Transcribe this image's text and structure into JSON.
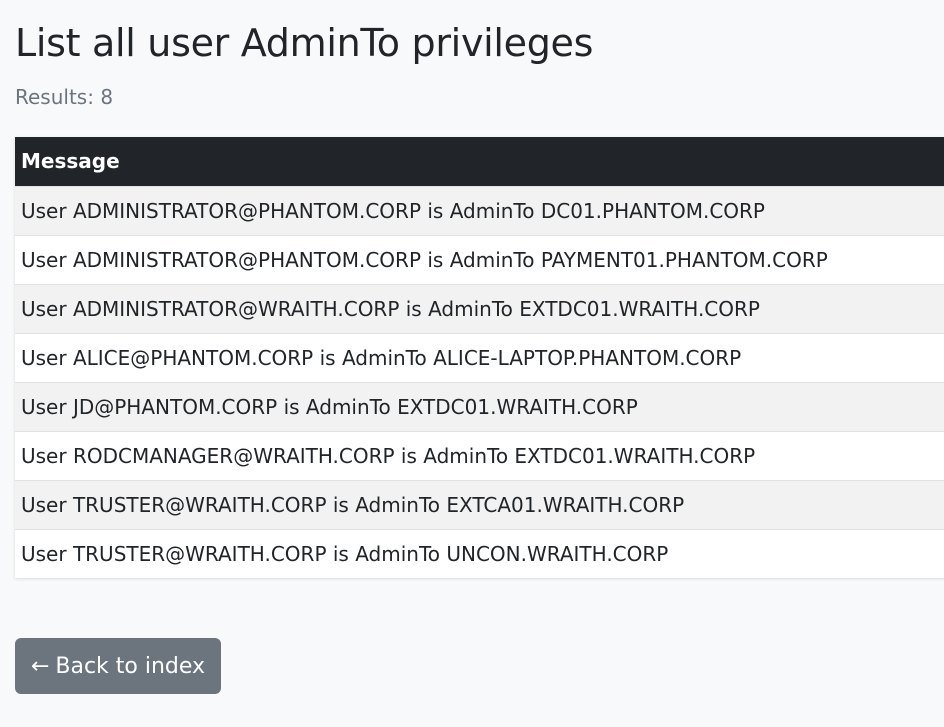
{
  "page": {
    "title": "List all user AdminTo privileges",
    "results_text": "Results: 8"
  },
  "table": {
    "header": "Message",
    "rows": [
      "User ADMINISTRATOR@PHANTOM.CORP is AdminTo DC01.PHANTOM.CORP",
      "User ADMINISTRATOR@PHANTOM.CORP is AdminTo PAYMENT01.PHANTOM.CORP",
      "User ADMINISTRATOR@WRAITH.CORP is AdminTo EXTDC01.WRAITH.CORP",
      "User ALICE@PHANTOM.CORP is AdminTo ALICE-LAPTOP.PHANTOM.CORP",
      "User JD@PHANTOM.CORP is AdminTo EXTDC01.WRAITH.CORP",
      "User RODCMANAGER@WRAITH.CORP is AdminTo EXTDC01.WRAITH.CORP",
      "User TRUSTER@WRAITH.CORP is AdminTo EXTCA01.WRAITH.CORP",
      "User TRUSTER@WRAITH.CORP is AdminTo UNCON.WRAITH.CORP"
    ]
  },
  "back_button": {
    "arrow": "←",
    "label": "Back to index",
    "icon": "left-arrow-icon"
  },
  "colors": {
    "background": "#f8f9fa",
    "header_bg": "#212529",
    "button_bg": "#6c757d",
    "muted_text": "#6c757d"
  }
}
